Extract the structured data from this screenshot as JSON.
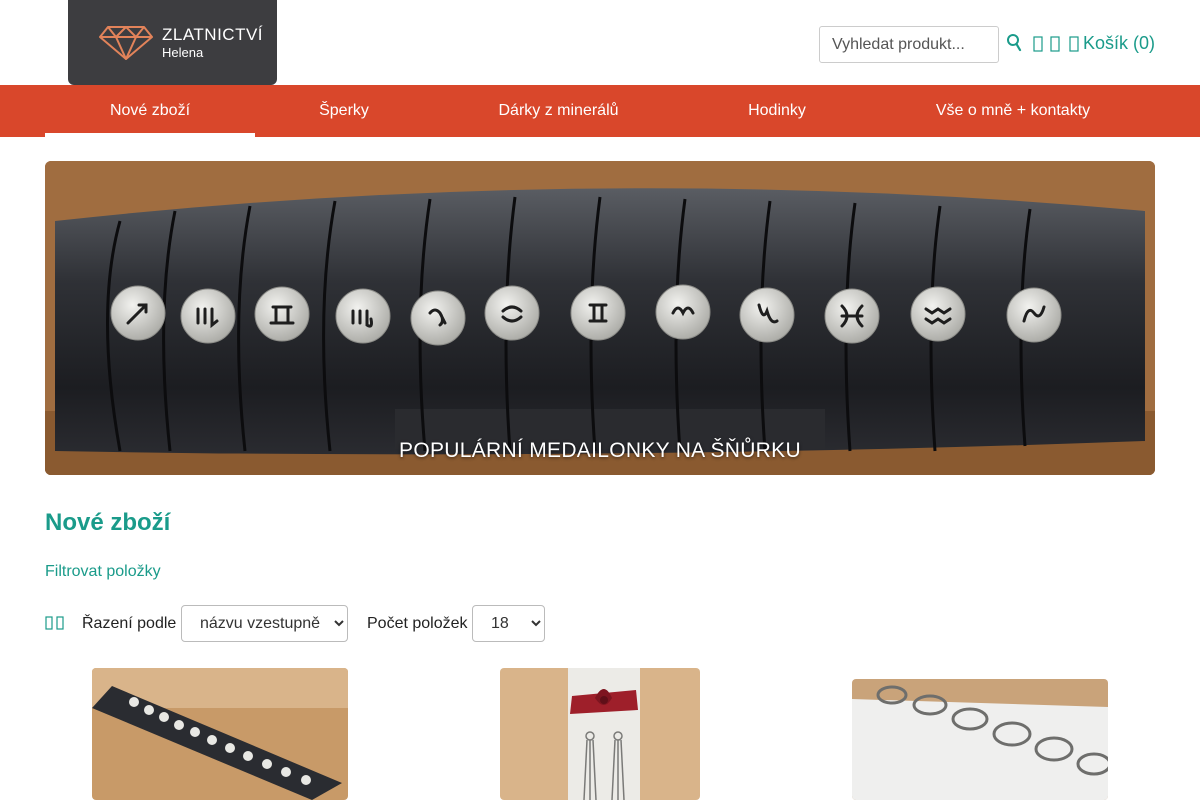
{
  "header": {
    "logo_title": "ZLATNICTVÍ",
    "logo_subtitle": "Helena",
    "search_placeholder": "Vyhledat produkt...",
    "cart_label": "Košík (0)",
    "icons": [
      "search-icon",
      "user-icon",
      "heart-icon",
      "cart-icon"
    ]
  },
  "nav": {
    "items": [
      {
        "label": "Nové zboží",
        "active": true
      },
      {
        "label": "Šperky",
        "active": false
      },
      {
        "label": "Dárky z minerálů",
        "active": false
      },
      {
        "label": "Hodinky",
        "active": false
      },
      {
        "label": "Vše o mně + kontakty",
        "active": false
      }
    ]
  },
  "banner": {
    "caption": "POPULÁRNÍ MEDAILONKY NA ŠŇŮRKU"
  },
  "main": {
    "title": "Nové zboží",
    "filter_link": "Filtrovat položky",
    "sort_label": "Řazení podle",
    "sort_value": "názvu vzestupně",
    "count_label": "Počet položek",
    "count_value": "18"
  },
  "colors": {
    "accent": "#1a9b8a",
    "nav_bg": "#d9472b",
    "logo_bg": "#3d3d40"
  }
}
